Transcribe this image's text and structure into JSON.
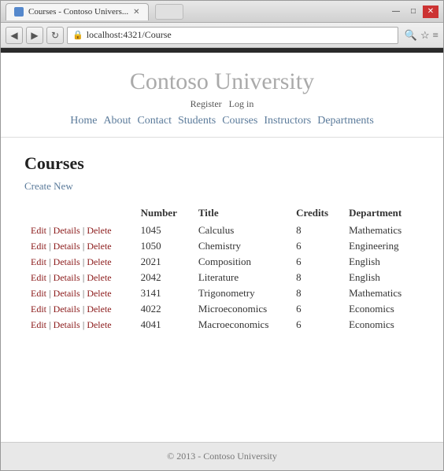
{
  "window": {
    "title": "Courses - Contoso Univers...",
    "url": "localhost:4321/Course"
  },
  "controls": {
    "minimize": "—",
    "maximize": "□",
    "close": "✕",
    "back": "◀",
    "forward": "▶",
    "refresh": "↻"
  },
  "header": {
    "site_title": "Contoso University",
    "register_label": "Register",
    "login_label": "Log in",
    "nav_items": [
      "Home",
      "About",
      "Contact",
      "Students",
      "Courses",
      "Instructors",
      "Departments"
    ]
  },
  "page": {
    "title": "Courses",
    "create_new_label": "Create New"
  },
  "table": {
    "columns": [
      "Number",
      "Title",
      "Credits",
      "Department"
    ],
    "rows": [
      {
        "number": "1045",
        "title": "Calculus",
        "credits": "8",
        "department": "Mathematics"
      },
      {
        "number": "1050",
        "title": "Chemistry",
        "credits": "6",
        "department": "Engineering"
      },
      {
        "number": "2021",
        "title": "Composition",
        "credits": "6",
        "department": "English"
      },
      {
        "number": "2042",
        "title": "Literature",
        "credits": "8",
        "department": "English"
      },
      {
        "number": "3141",
        "title": "Trigonometry",
        "credits": "8",
        "department": "Mathematics"
      },
      {
        "number": "4022",
        "title": "Microeconomics",
        "credits": "6",
        "department": "Economics"
      },
      {
        "number": "4041",
        "title": "Macroeconomics",
        "credits": "6",
        "department": "Economics"
      }
    ],
    "action_edit": "Edit",
    "action_details": "Details",
    "action_delete": "Delete",
    "action_sep": "|"
  },
  "footer": {
    "copyright": "© 2013 - Contoso University"
  }
}
